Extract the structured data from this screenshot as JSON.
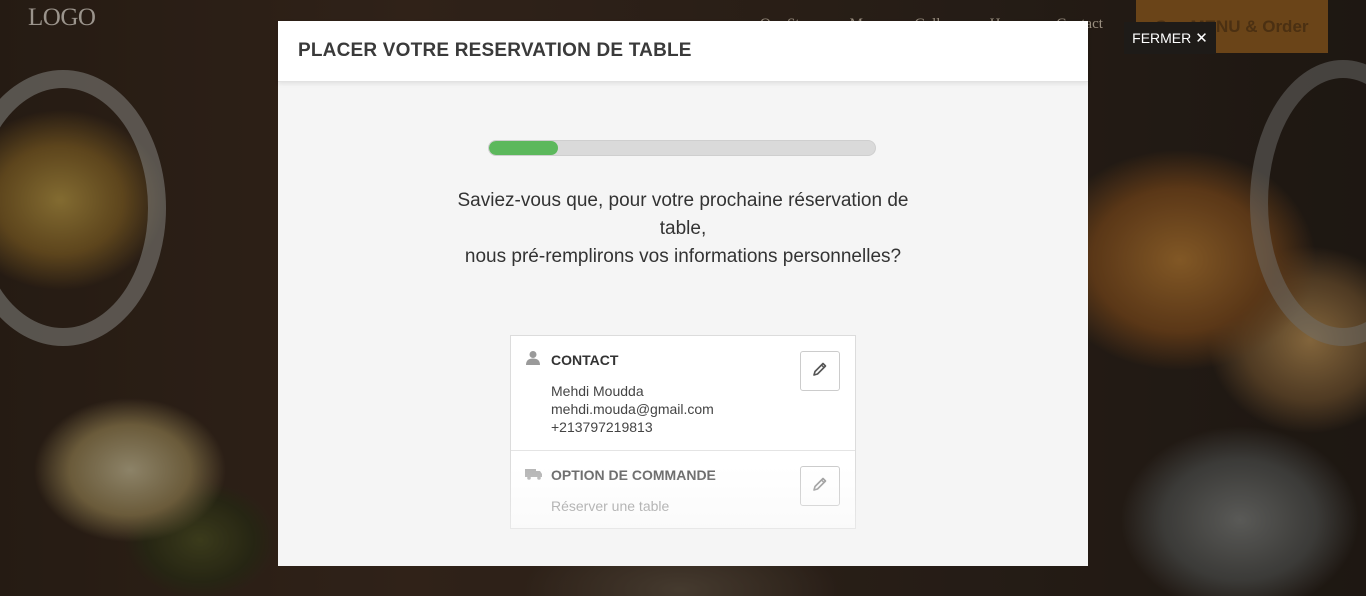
{
  "background": {
    "logo": "LOGO",
    "nav_items": [
      "Our Story",
      "Menu",
      "Gallery",
      "Hours",
      "Contact"
    ],
    "order_button": "See MENU & Order"
  },
  "close_button": {
    "label": "FERMER",
    "icon": "close-icon"
  },
  "modal": {
    "title": "PLACER VOTRE RESERVATION DE TABLE",
    "progress_percent": 18,
    "progress_color": "#5cb85c",
    "info_lines": [
      "Saviez-vous que, pour votre prochaine réservation de",
      "table,",
      "nous pré-remplirons vos informations personnelles?"
    ],
    "contact": {
      "title": "CONTACT",
      "icon": "user-icon",
      "name": "Mehdi Moudda",
      "email": "mehdi.mouda@gmail.com",
      "phone": "+213797219813",
      "edit_icon": "pencil-icon"
    },
    "order_option": {
      "title": "OPTION DE COMMANDE",
      "icon": "truck-icon",
      "value": "Réserver une table",
      "edit_icon": "pencil-icon"
    }
  }
}
